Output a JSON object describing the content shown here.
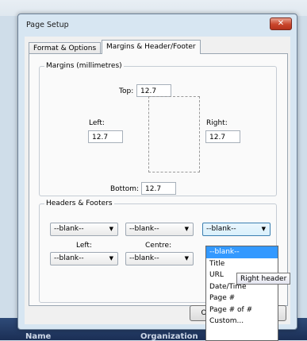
{
  "dialog": {
    "title": "Page Setup",
    "close_glyph": "✕",
    "tabs": [
      {
        "label": "Format & Options"
      },
      {
        "label": "Margins & Header/Footer"
      }
    ]
  },
  "margins": {
    "legend": "Margins (millimetres)",
    "top_label": "Top:",
    "top_value": "12.7",
    "left_label": "Left:",
    "left_value": "12.7",
    "right_label": "Right:",
    "right_value": "12.7",
    "bottom_label": "Bottom:",
    "bottom_value": "12.7"
  },
  "headers_footers": {
    "legend": "Headers & Footers",
    "header_left": "--blank--",
    "header_centre": "--blank--",
    "header_right": "--blank--",
    "left_label": "Left:",
    "centre_label": "Centre:",
    "footer_left": "--blank--",
    "footer_centre": "--blank--"
  },
  "dropdown": {
    "options": [
      "--blank--",
      "Title",
      "URL",
      "Date/Time",
      "Page #",
      "Page # of #",
      "Custom..."
    ],
    "selected_index": 0
  },
  "tooltip": "Right header",
  "buttons": {
    "ok_partial": "O"
  },
  "background": {
    "col1": "Name",
    "col2": "Organization"
  },
  "icons": {
    "dropdown_arrow": "▼"
  }
}
